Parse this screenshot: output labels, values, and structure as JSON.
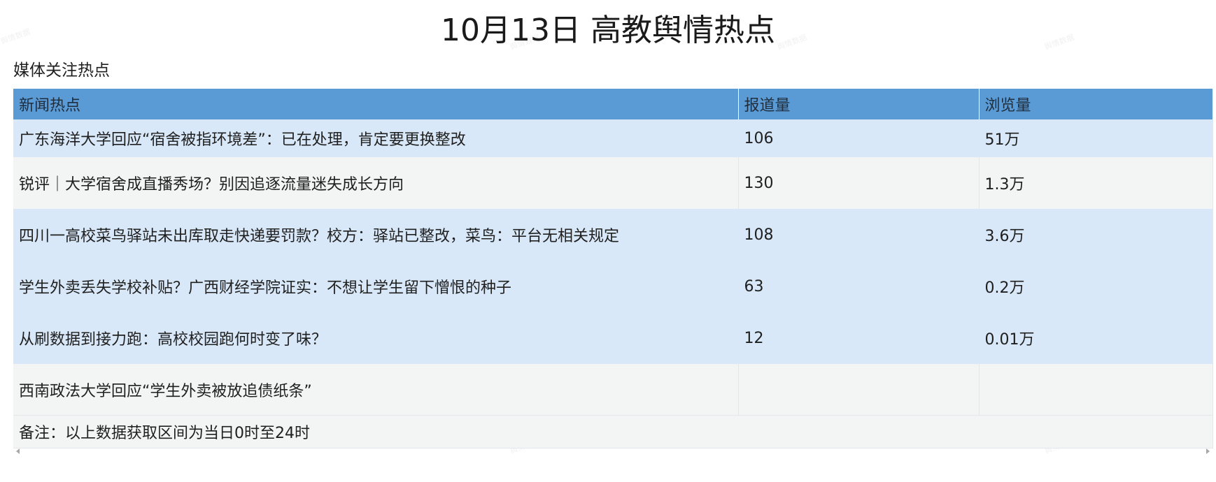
{
  "page": {
    "title": "10月13日 高教舆情热点",
    "section": "媒体关注热点"
  },
  "table": {
    "headers": [
      "新闻热点",
      "报道量",
      "浏览量"
    ],
    "rows": [
      {
        "topic": "广东海洋大学回应“宿舍被指环境差”：已在处理，肯定要更换整改",
        "reports": "106",
        "views": "51万"
      },
      {
        "topic": "锐评｜大学宿舍成直播秀场？别因追逐流量迷失成长方向",
        "reports": "130",
        "views": "1.3万"
      },
      {
        "topic": "四川一高校菜鸟驿站未出库取走快递要罚款？校方：驿站已整改，菜鸟：平台无相关规定",
        "reports": "108",
        "views": "3.6万"
      },
      {
        "topic": "学生外卖丢失学校补贴？广西财经学院证实：不想让学生留下憎恨的种子",
        "reports": "63",
        "views": "0.2万"
      },
      {
        "topic": "从刷数据到接力跑：高校校园跑何时变了味？",
        "reports": "12",
        "views": "0.01万"
      },
      {
        "topic": "西南政法大学回应“学生外卖被放追债纸条”",
        "reports": "",
        "views": ""
      }
    ],
    "note": "备注：以上数据获取区间为当日0时至24时"
  },
  "icons": {
    "scroll_left": "scroll-left-arrow-icon",
    "scroll_right": "scroll-right-arrow-icon"
  },
  "colors": {
    "header_bg": "#5b9bd5",
    "row_blue": "#d9e8f8",
    "row_gray": "#f3f4f4"
  }
}
